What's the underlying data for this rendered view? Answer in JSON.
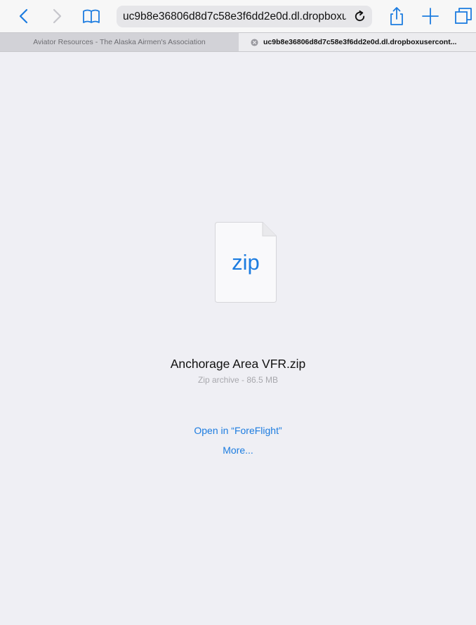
{
  "toolbar": {
    "back_icon": "chevron-left-icon",
    "forward_icon": "chevron-right-icon",
    "bookmarks_icon": "book-icon",
    "address": "uc9b8e36806d8d7c58e3f6dd2e0d.dl.dropboxusercontent.com",
    "reload_icon": "reload-icon",
    "share_icon": "share-icon",
    "new_tab_icon": "plus-icon",
    "tabs_icon": "tabs-icon"
  },
  "tabs": [
    {
      "label": "Aviator Resources - The Alaska Airmen's Association",
      "active": false
    },
    {
      "label": "uc9b8e36806d8d7c58e3f6dd2e0d.dl.dropboxusercont...",
      "active": true,
      "close_icon": "close-icon"
    }
  ],
  "file": {
    "icon": "zip-file-icon",
    "extension": "zip",
    "name": "Anchorage Area VFR.zip",
    "meta": "Zip archive - 86.5 MB"
  },
  "actions": {
    "open_in": "Open in “ForeFlight”",
    "more": "More..."
  },
  "colors": {
    "accent": "#1c7ce0",
    "background": "#efeff4",
    "toolbar": "#f7f7f7"
  }
}
